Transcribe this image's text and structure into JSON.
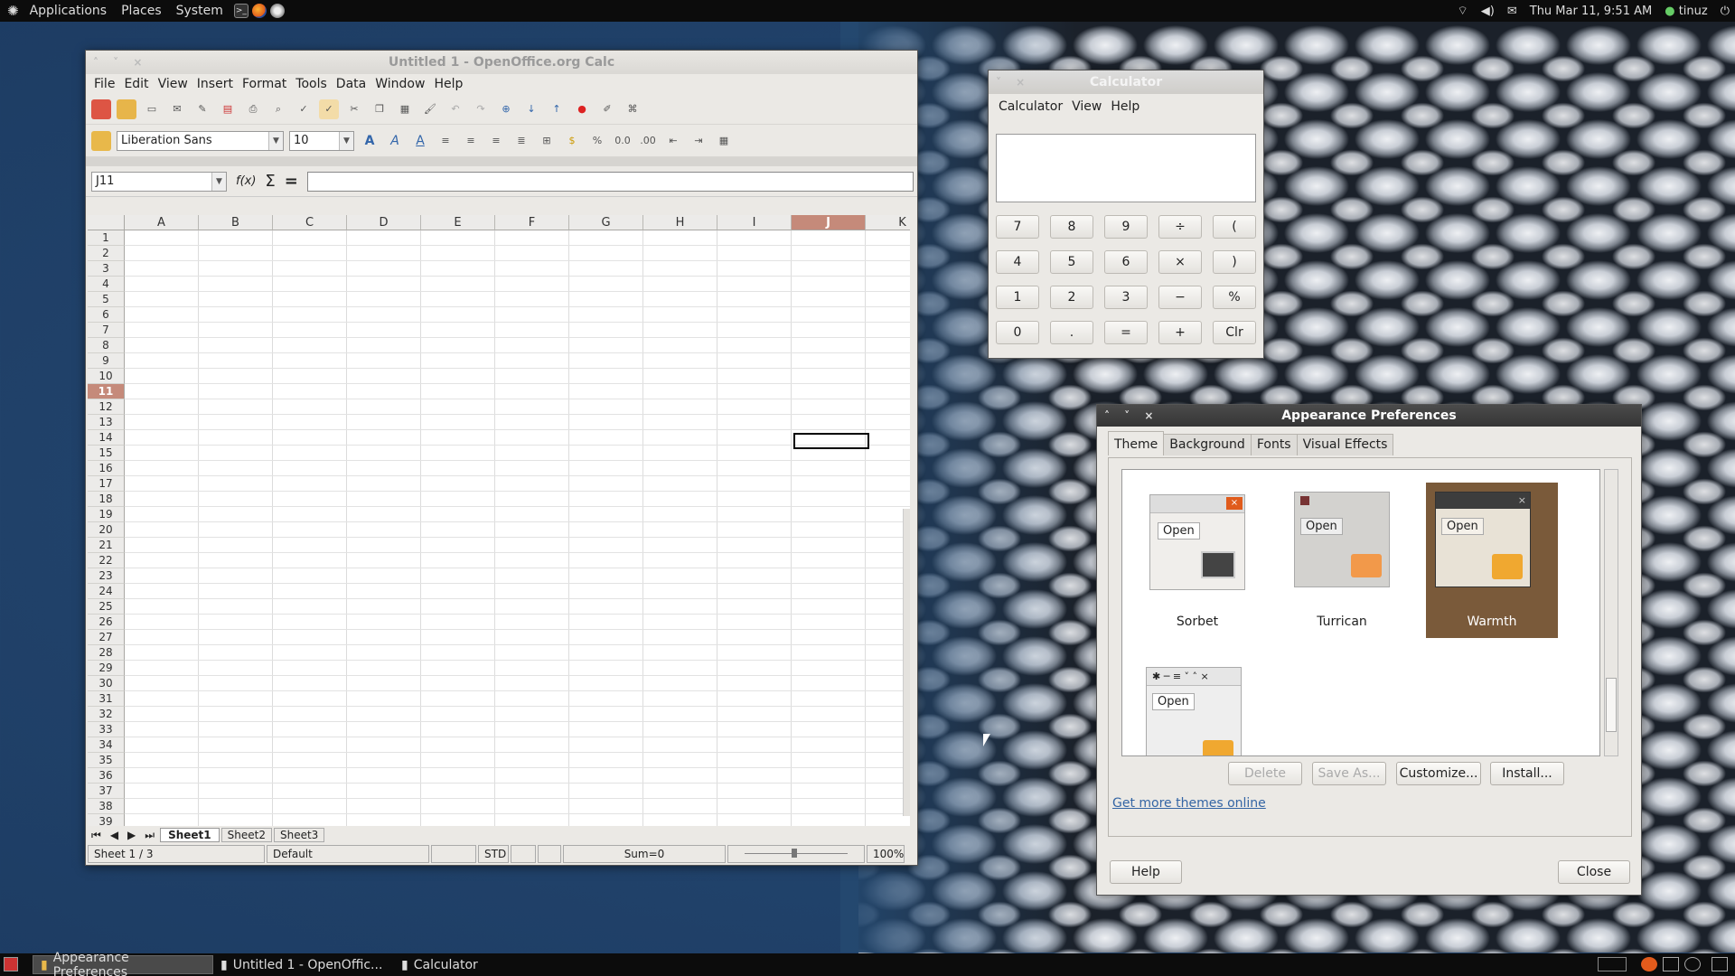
{
  "top_panel": {
    "menus": [
      "Applications",
      "Places",
      "System"
    ],
    "clock": "Thu Mar 11,  9:51 AM",
    "user": "tinuz"
  },
  "calc_app": {
    "title": "Untitled 1 - OpenOffice.org Calc",
    "menu": [
      "File",
      "Edit",
      "View",
      "Insert",
      "Format",
      "Tools",
      "Data",
      "Window",
      "Help"
    ],
    "font_name": "Liberation Sans",
    "font_size": "10",
    "cell_ref": "J11",
    "fx": "f(x)",
    "sum": "Σ",
    "eq": "=",
    "columns": [
      "A",
      "B",
      "C",
      "D",
      "E",
      "F",
      "G",
      "H",
      "I",
      "J",
      "K"
    ],
    "rows": [
      "1",
      "2",
      "3",
      "4",
      "5",
      "6",
      "7",
      "8",
      "9",
      "10",
      "11",
      "12",
      "13",
      "14",
      "15",
      "16",
      "17",
      "18",
      "19",
      "20",
      "21",
      "22",
      "23",
      "24",
      "25",
      "26",
      "27",
      "28",
      "29",
      "30",
      "31",
      "32",
      "33",
      "34",
      "35",
      "36",
      "37",
      "38",
      "39"
    ],
    "sheets": [
      "Sheet1",
      "Sheet2",
      "Sheet3"
    ],
    "status": {
      "sheet": "Sheet 1 / 3",
      "style": "Default",
      "mode": "STD",
      "sum": "Sum=0",
      "zoom": "100%"
    }
  },
  "calculator": {
    "title": "Calculator",
    "menu": [
      "Calculator",
      "View",
      "Help"
    ],
    "display": "",
    "keys": [
      [
        "7",
        "8",
        "9",
        "÷",
        "("
      ],
      [
        "4",
        "5",
        "6",
        "×",
        ")"
      ],
      [
        "1",
        "2",
        "3",
        "−",
        "%"
      ],
      [
        "0",
        ".",
        "=",
        "+",
        "Clr"
      ]
    ]
  },
  "appearance": {
    "title": "Appearance Preferences",
    "tabs": [
      "Theme",
      "Background",
      "Fonts",
      "Visual Effects"
    ],
    "themes": [
      {
        "name": "Sorbet",
        "open": "Open"
      },
      {
        "name": "Turrican",
        "open": "Open"
      },
      {
        "name": "Warmth",
        "open": "Open"
      },
      {
        "name": "",
        "open": "Open"
      }
    ],
    "buttons": {
      "delete": "Delete",
      "save_as": "Save As...",
      "customize": "Customize...",
      "install": "Install...",
      "help": "Help",
      "close": "Close"
    },
    "link": "Get more themes online"
  },
  "taskbar": [
    {
      "label": "Appearance Preferences"
    },
    {
      "label": "Untitled 1 - OpenOffic..."
    },
    {
      "label": "Calculator"
    }
  ],
  "colors": {
    "accent_orange": "#e05b1c",
    "warmth_bg": "#7a5a3a",
    "link": "#3465a4"
  }
}
